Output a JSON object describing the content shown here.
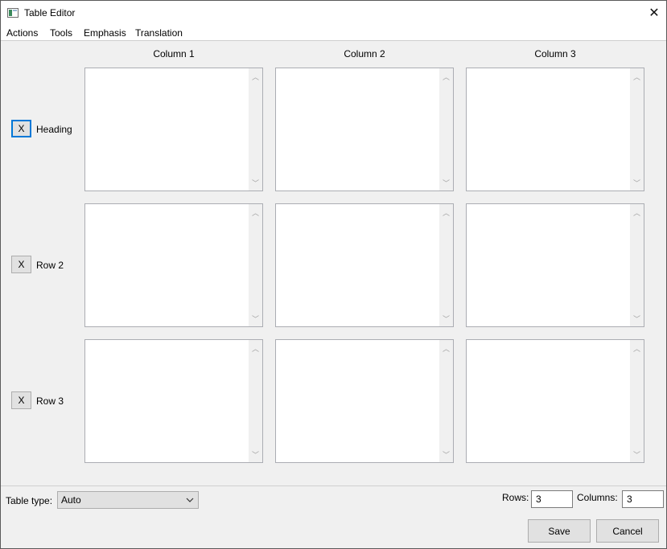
{
  "window": {
    "title": "Table Editor"
  },
  "menu": [
    "Actions",
    "Tools",
    "Emphasis",
    "Translation"
  ],
  "columns": [
    "Column 1",
    "Column 2",
    "Column 3"
  ],
  "rows": [
    {
      "button": "X",
      "label": "Heading"
    },
    {
      "button": "X",
      "label": "Row 2"
    },
    {
      "button": "X",
      "label": "Row 3"
    }
  ],
  "cells": [
    [
      "",
      "",
      ""
    ],
    [
      "",
      "",
      ""
    ],
    [
      "",
      "",
      ""
    ]
  ],
  "footer": {
    "table_type_label": "Table type:",
    "table_type_value": "Auto",
    "rows_label": "Rows:",
    "rows_value": "3",
    "columns_label": "Columns:",
    "columns_value": "3",
    "save_label": "Save",
    "cancel_label": "Cancel"
  },
  "icons": {
    "app": "table-app-icon",
    "close": "close-icon",
    "dropdown": "chevron-down-icon",
    "scroll_up": "scroll-up-arrow-icon",
    "scroll_down": "scroll-down-arrow-icon"
  },
  "colors": {
    "window_bg": "#f0f0f0",
    "focus_accent": "#0078d7",
    "button_bg": "#e1e1e1"
  }
}
